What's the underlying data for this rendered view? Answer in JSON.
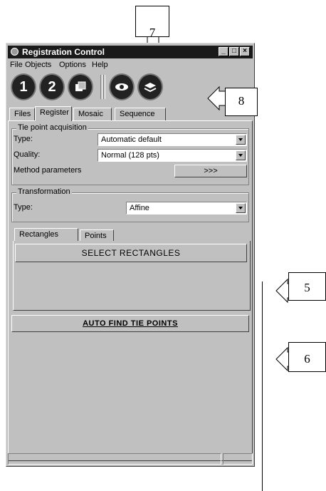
{
  "window": {
    "title": "Registration Control",
    "titlebar_buttons": [
      "minimize",
      "maximize",
      "close"
    ]
  },
  "menu": [
    "File",
    "Objects",
    "Options",
    "Help"
  ],
  "toolbar": {
    "buttons": [
      {
        "label": "1",
        "icon": "step-1-icon"
      },
      {
        "label": "2",
        "icon": "step-2-icon"
      },
      {
        "label": "",
        "icon": "overlay-icon"
      },
      {
        "label": "",
        "icon": "eye-icon"
      },
      {
        "label": "",
        "icon": "layers-icon"
      }
    ]
  },
  "tabs": [
    "Files",
    "Register",
    "Mosaic",
    "Sequence"
  ],
  "active_tab": "Register",
  "tie_point_acquisition": {
    "label": "Tie point acquisition",
    "type_label": "Type:",
    "type_value": "Automatic default",
    "quality_label": "Quality:",
    "quality_value": "Normal (128 pts)",
    "method_label": "Method parameters",
    "method_button": ">>>"
  },
  "transformation": {
    "label": "Transformation",
    "type_label": "Type:",
    "type_value": "Affine"
  },
  "subtabs": [
    "Rectangles",
    "Points"
  ],
  "select_rectangles_button": "SELECT RECTANGLES",
  "auto_find_button": "AUTO FIND TIE POINTS",
  "callouts": [
    "7",
    "8",
    "5",
    "6"
  ],
  "colors": {
    "titlebar": "#1a1a1a",
    "face": "#c0c0c0"
  }
}
